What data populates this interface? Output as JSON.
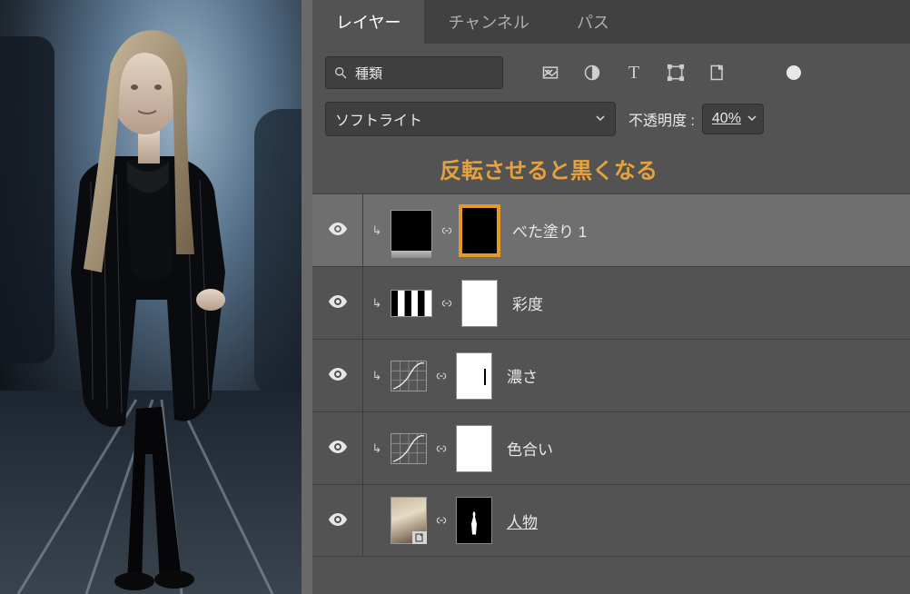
{
  "tabs": {
    "layers": "レイヤー",
    "channels": "チャンネル",
    "paths": "パス"
  },
  "filter": {
    "placeholder": "種類"
  },
  "blend": {
    "mode": "ソフトライト",
    "opacity_label": "不透明度 :",
    "opacity_value": "40%"
  },
  "annotation": "反転させると黒くなる",
  "layers": [
    {
      "name": "べた塗り 1",
      "mask": "black",
      "thumb": "solid",
      "clipped": true,
      "highlighted": true,
      "selected": true
    },
    {
      "name": "彩度",
      "mask": "white",
      "thumb": "grad",
      "clipped": true
    },
    {
      "name": "濃さ",
      "mask": "white-mark",
      "thumb": "curve",
      "clipped": true
    },
    {
      "name": "色合い",
      "mask": "white",
      "thumb": "curve",
      "clipped": true
    },
    {
      "name": "人物",
      "mask": "silhouette",
      "thumb": "photo",
      "clipped": false,
      "underline": true
    }
  ]
}
